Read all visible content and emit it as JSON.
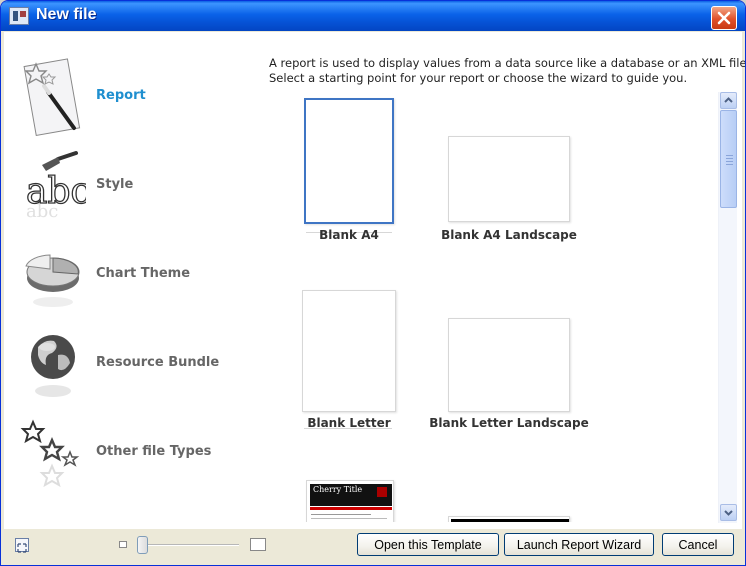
{
  "window": {
    "title": "New file"
  },
  "categories": [
    {
      "label": "Report",
      "icon": "report-wand-icon",
      "selected": true
    },
    {
      "label": "Style",
      "icon": "style-brush-icon",
      "selected": false
    },
    {
      "label": "Chart Theme",
      "icon": "pie-chart-icon",
      "selected": false
    },
    {
      "label": "Resource Bundle",
      "icon": "globe-icon",
      "selected": false
    },
    {
      "label": "Other file Types",
      "icon": "stars-icon",
      "selected": false
    }
  ],
  "description": {
    "line1": "A report is used to display values from a data source like a database or an XML file.",
    "line2": "Select a starting point for your report or choose the wizard to guide you."
  },
  "templates": [
    {
      "label": "Blank A4",
      "selected": true
    },
    {
      "label": "Blank A4 Landscape",
      "selected": false
    },
    {
      "label": "Blank Letter",
      "selected": false
    },
    {
      "label": "Blank Letter Landscape",
      "selected": false
    },
    {
      "label": "",
      "preview_title": "Cherry Title",
      "selected": false
    },
    {
      "label": "",
      "selected": false
    }
  ],
  "footer": {
    "open_template_label": "Open this Template",
    "launch_wizard_label": "Launch Report Wizard",
    "cancel_label": "Cancel"
  },
  "colors": {
    "titlebar": "#0a5fe3",
    "selected_category": "#1f8fcf",
    "selected_template_border": "#3f75c4"
  }
}
